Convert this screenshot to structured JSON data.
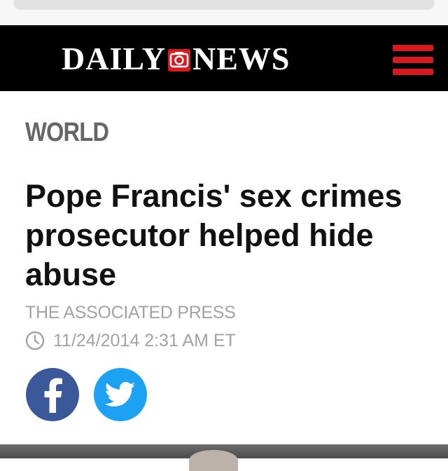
{
  "header": {
    "logo_text_left": "DAILY",
    "logo_text_right": "NEWS",
    "brand_color": "#d71920",
    "menu_icon": "hamburger-menu-icon"
  },
  "article": {
    "section": "WORLD",
    "headline": "Pope Francis' sex crimes prosecutor helped hide abuse",
    "byline": "THE ASSOCIATED PRESS",
    "timestamp": "11/24/2014 2:31 AM ET",
    "timestamp_icon": "clock-icon"
  },
  "share": {
    "facebook_icon": "facebook-icon",
    "facebook_color": "#3b5998",
    "twitter_icon": "twitter-icon",
    "twitter_color": "#1da1f2"
  }
}
